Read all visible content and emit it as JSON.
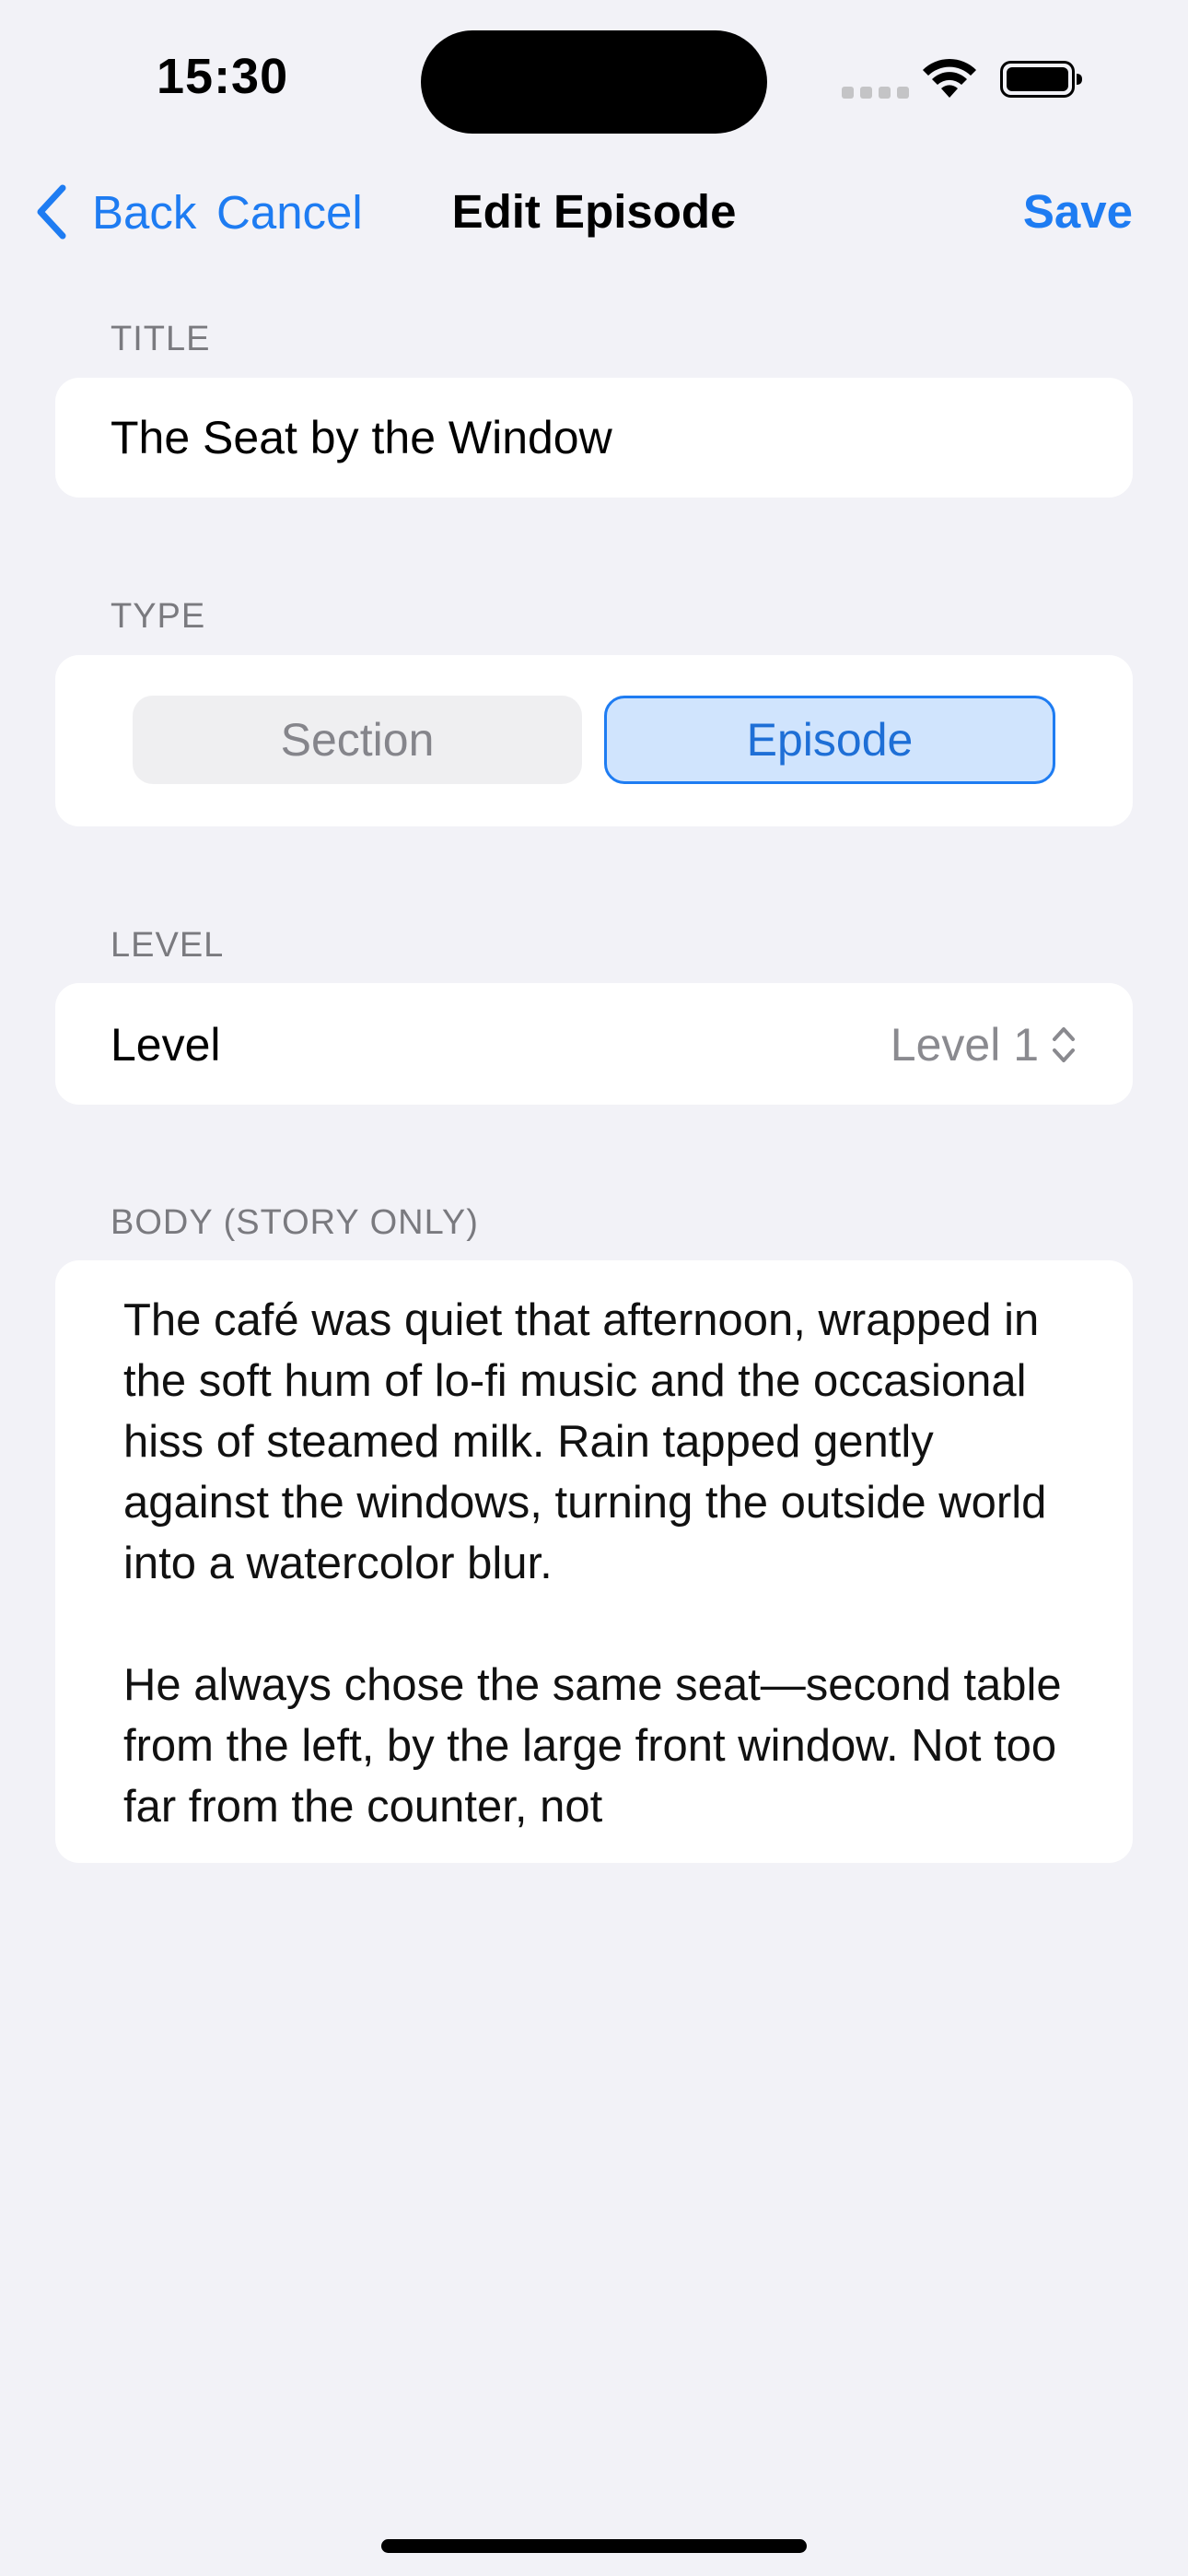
{
  "status_bar": {
    "time": "15:30"
  },
  "nav": {
    "back_label": "Back",
    "cancel_label": "Cancel",
    "title": "Edit Episode",
    "save_label": "Save"
  },
  "title_section": {
    "label": "TITLE",
    "value": "The Seat by the Window"
  },
  "type_section": {
    "label": "TYPE",
    "options": [
      "Section",
      "Episode"
    ],
    "selected": "Episode"
  },
  "level_section": {
    "label": "LEVEL",
    "row_label": "Level",
    "value": "Level 1"
  },
  "body_section": {
    "label": "BODY (STORY ONLY)",
    "paragraphs": [
      "The café was quiet that afternoon, wrapped in the soft hum of lo-fi music and the occasional hiss of steamed milk. Rain tapped gently against the windows, turning the outside world into a watercolor blur.",
      "He always chose the same seat—second table from the left, by the large front window. Not too far from the counter, not"
    ]
  },
  "colors": {
    "accent": "#1e7cf2",
    "background": "#f2f2f7",
    "selected_segment_fill": "#d0e4fd"
  }
}
